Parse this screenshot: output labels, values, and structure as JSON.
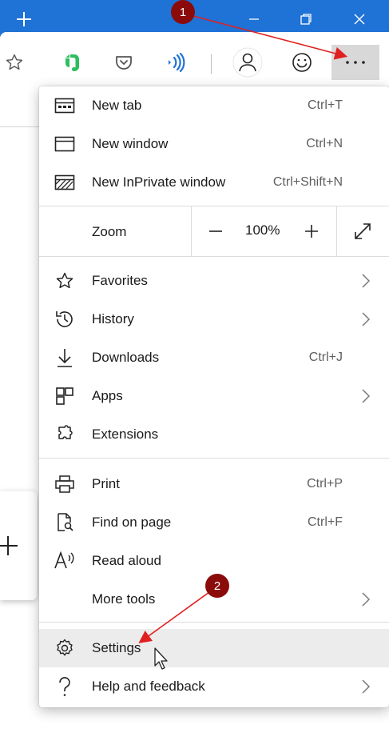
{
  "titlebar": {
    "bg": "#1f72d6"
  },
  "menu": {
    "items_top": [
      {
        "label": "New tab",
        "shortcut": "Ctrl+T"
      },
      {
        "label": "New window",
        "shortcut": "Ctrl+N"
      },
      {
        "label": "New InPrivate window",
        "shortcut": "Ctrl+Shift+N"
      }
    ],
    "zoom": {
      "label": "Zoom",
      "value": "100%"
    },
    "items_mid": [
      {
        "label": "Favorites",
        "shortcut": ""
      },
      {
        "label": "History",
        "shortcut": ""
      },
      {
        "label": "Downloads",
        "shortcut": "Ctrl+J"
      },
      {
        "label": "Apps",
        "shortcut": ""
      },
      {
        "label": "Extensions",
        "shortcut": ""
      }
    ],
    "items_tools": [
      {
        "label": "Print",
        "shortcut": "Ctrl+P"
      },
      {
        "label": "Find on page",
        "shortcut": "Ctrl+F"
      },
      {
        "label": "Read aloud",
        "shortcut": ""
      },
      {
        "label": "More tools",
        "shortcut": ""
      }
    ],
    "items_bottom": [
      {
        "label": "Settings",
        "shortcut": ""
      },
      {
        "label": "Help and feedback",
        "shortcut": ""
      }
    ]
  },
  "annotations": [
    {
      "number": "1"
    },
    {
      "number": "2"
    }
  ],
  "colors": {
    "accent": "#1f72d6",
    "badge": "#8b0b0b",
    "arrow": "#e02020",
    "evernote": "#2dbe60",
    "wifi": "#1f72d6"
  }
}
